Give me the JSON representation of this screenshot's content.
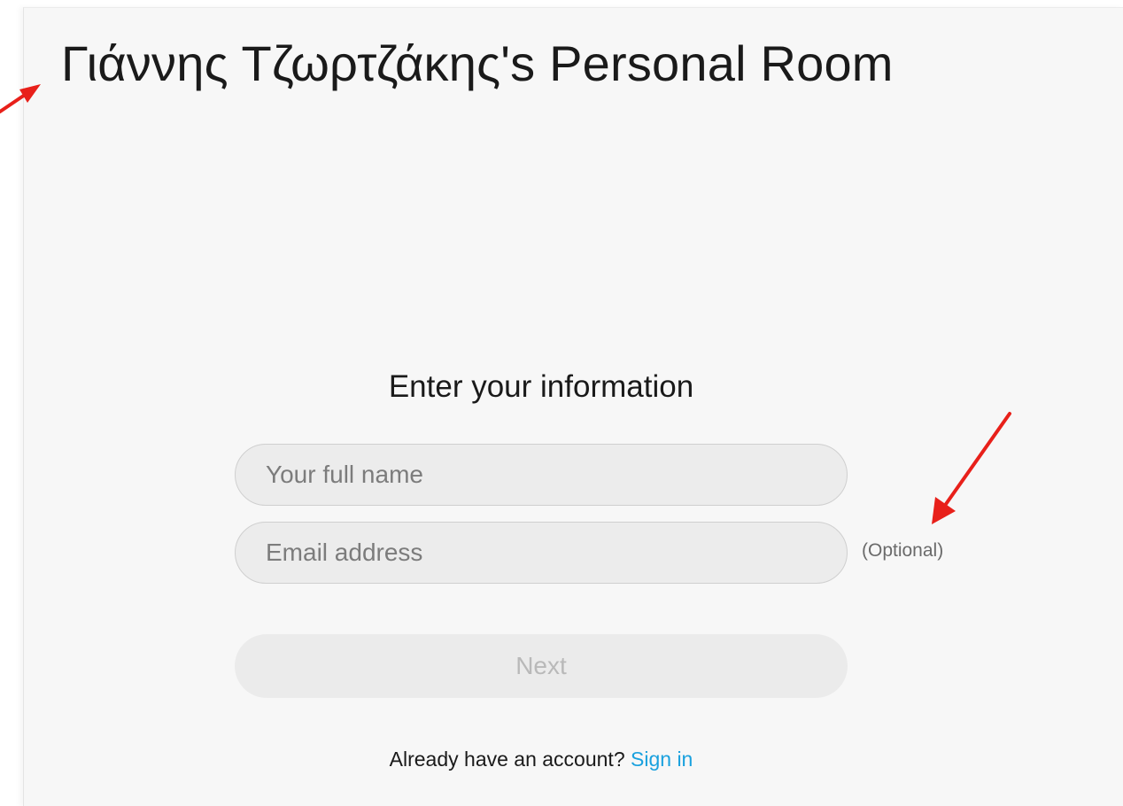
{
  "room": {
    "title": "Γιάννης Τζωρτζάκης's Personal Room"
  },
  "form": {
    "heading": "Enter your information",
    "name_placeholder": "Your full name",
    "email_placeholder": "Email address",
    "email_optional_label": "(Optional)",
    "next_label": "Next"
  },
  "signin": {
    "prompt": "Already have an account?",
    "link_label": "Sign in"
  },
  "colors": {
    "link": "#1aa1de",
    "annotation_arrow": "#e8201a",
    "panel_background": "#f7f7f7"
  },
  "icons": [
    "red-annotation-arrow"
  ]
}
